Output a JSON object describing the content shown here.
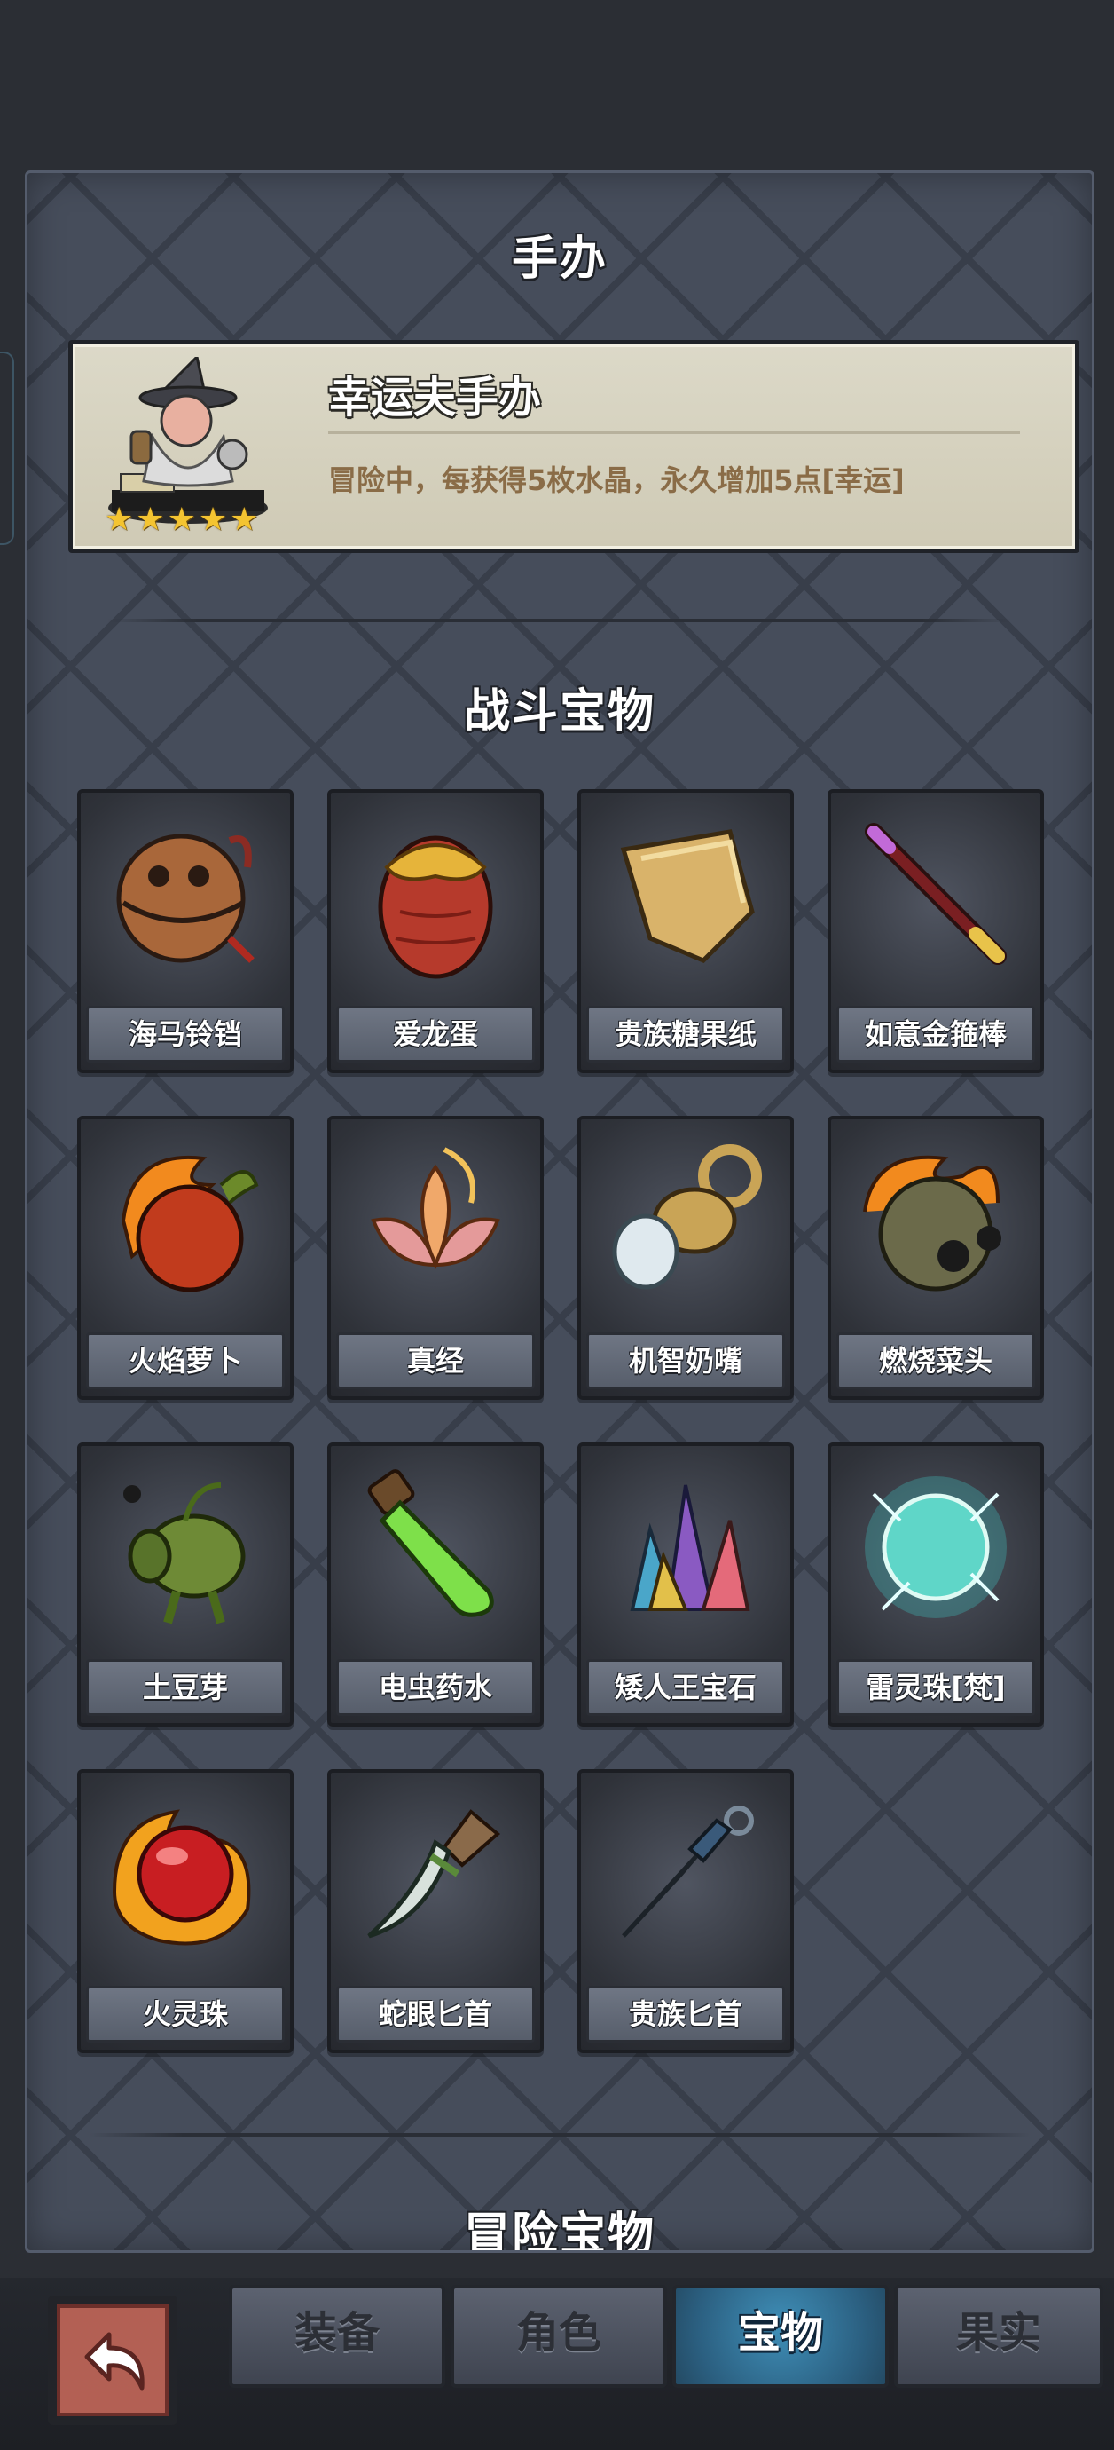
{
  "sections": {
    "figure_title": "手办",
    "battle_title": "战斗宝物",
    "adventure_title": "冒险宝物"
  },
  "figure": {
    "name": "幸运夫手办",
    "description": "冒险中，每获得5枚水晶，永久增加5点[幸运]",
    "stars": 5
  },
  "battle_items": [
    {
      "label": "海马铃铛",
      "icon": "bell-icon"
    },
    {
      "label": "爱龙蛋",
      "icon": "dragon-egg-icon"
    },
    {
      "label": "贵族糖果纸",
      "icon": "candy-wrapper-icon"
    },
    {
      "label": "如意金箍棒",
      "icon": "golden-staff-icon"
    },
    {
      "label": "火焰萝卜",
      "icon": "fire-radish-icon"
    },
    {
      "label": "真经",
      "icon": "lotus-scripture-icon"
    },
    {
      "label": "机智奶嘴",
      "icon": "pacifier-icon"
    },
    {
      "label": "燃烧菜头",
      "icon": "burning-cabbage-icon"
    },
    {
      "label": "土豆芽",
      "icon": "potato-sprout-icon"
    },
    {
      "label": "电虫药水",
      "icon": "green-potion-icon"
    },
    {
      "label": "矮人王宝石",
      "icon": "gem-crystals-icon"
    },
    {
      "label": "雷灵珠[梵]",
      "icon": "thunder-orb-icon"
    },
    {
      "label": "火灵珠",
      "icon": "fire-orb-icon"
    },
    {
      "label": "蛇眼匕首",
      "icon": "snake-dagger-icon"
    },
    {
      "label": "贵族匕首",
      "icon": "noble-dagger-icon"
    }
  ],
  "tabs": [
    {
      "label": "装备",
      "active": false
    },
    {
      "label": "角色",
      "active": false
    },
    {
      "label": "宝物",
      "active": true
    },
    {
      "label": "果实",
      "active": false
    }
  ],
  "colors": {
    "panel_bg": "#464d5b",
    "active_tab": "#3f8fb8",
    "back_button": "#b36054",
    "star": "#f4c431",
    "desc_text": "#8a6c47"
  }
}
